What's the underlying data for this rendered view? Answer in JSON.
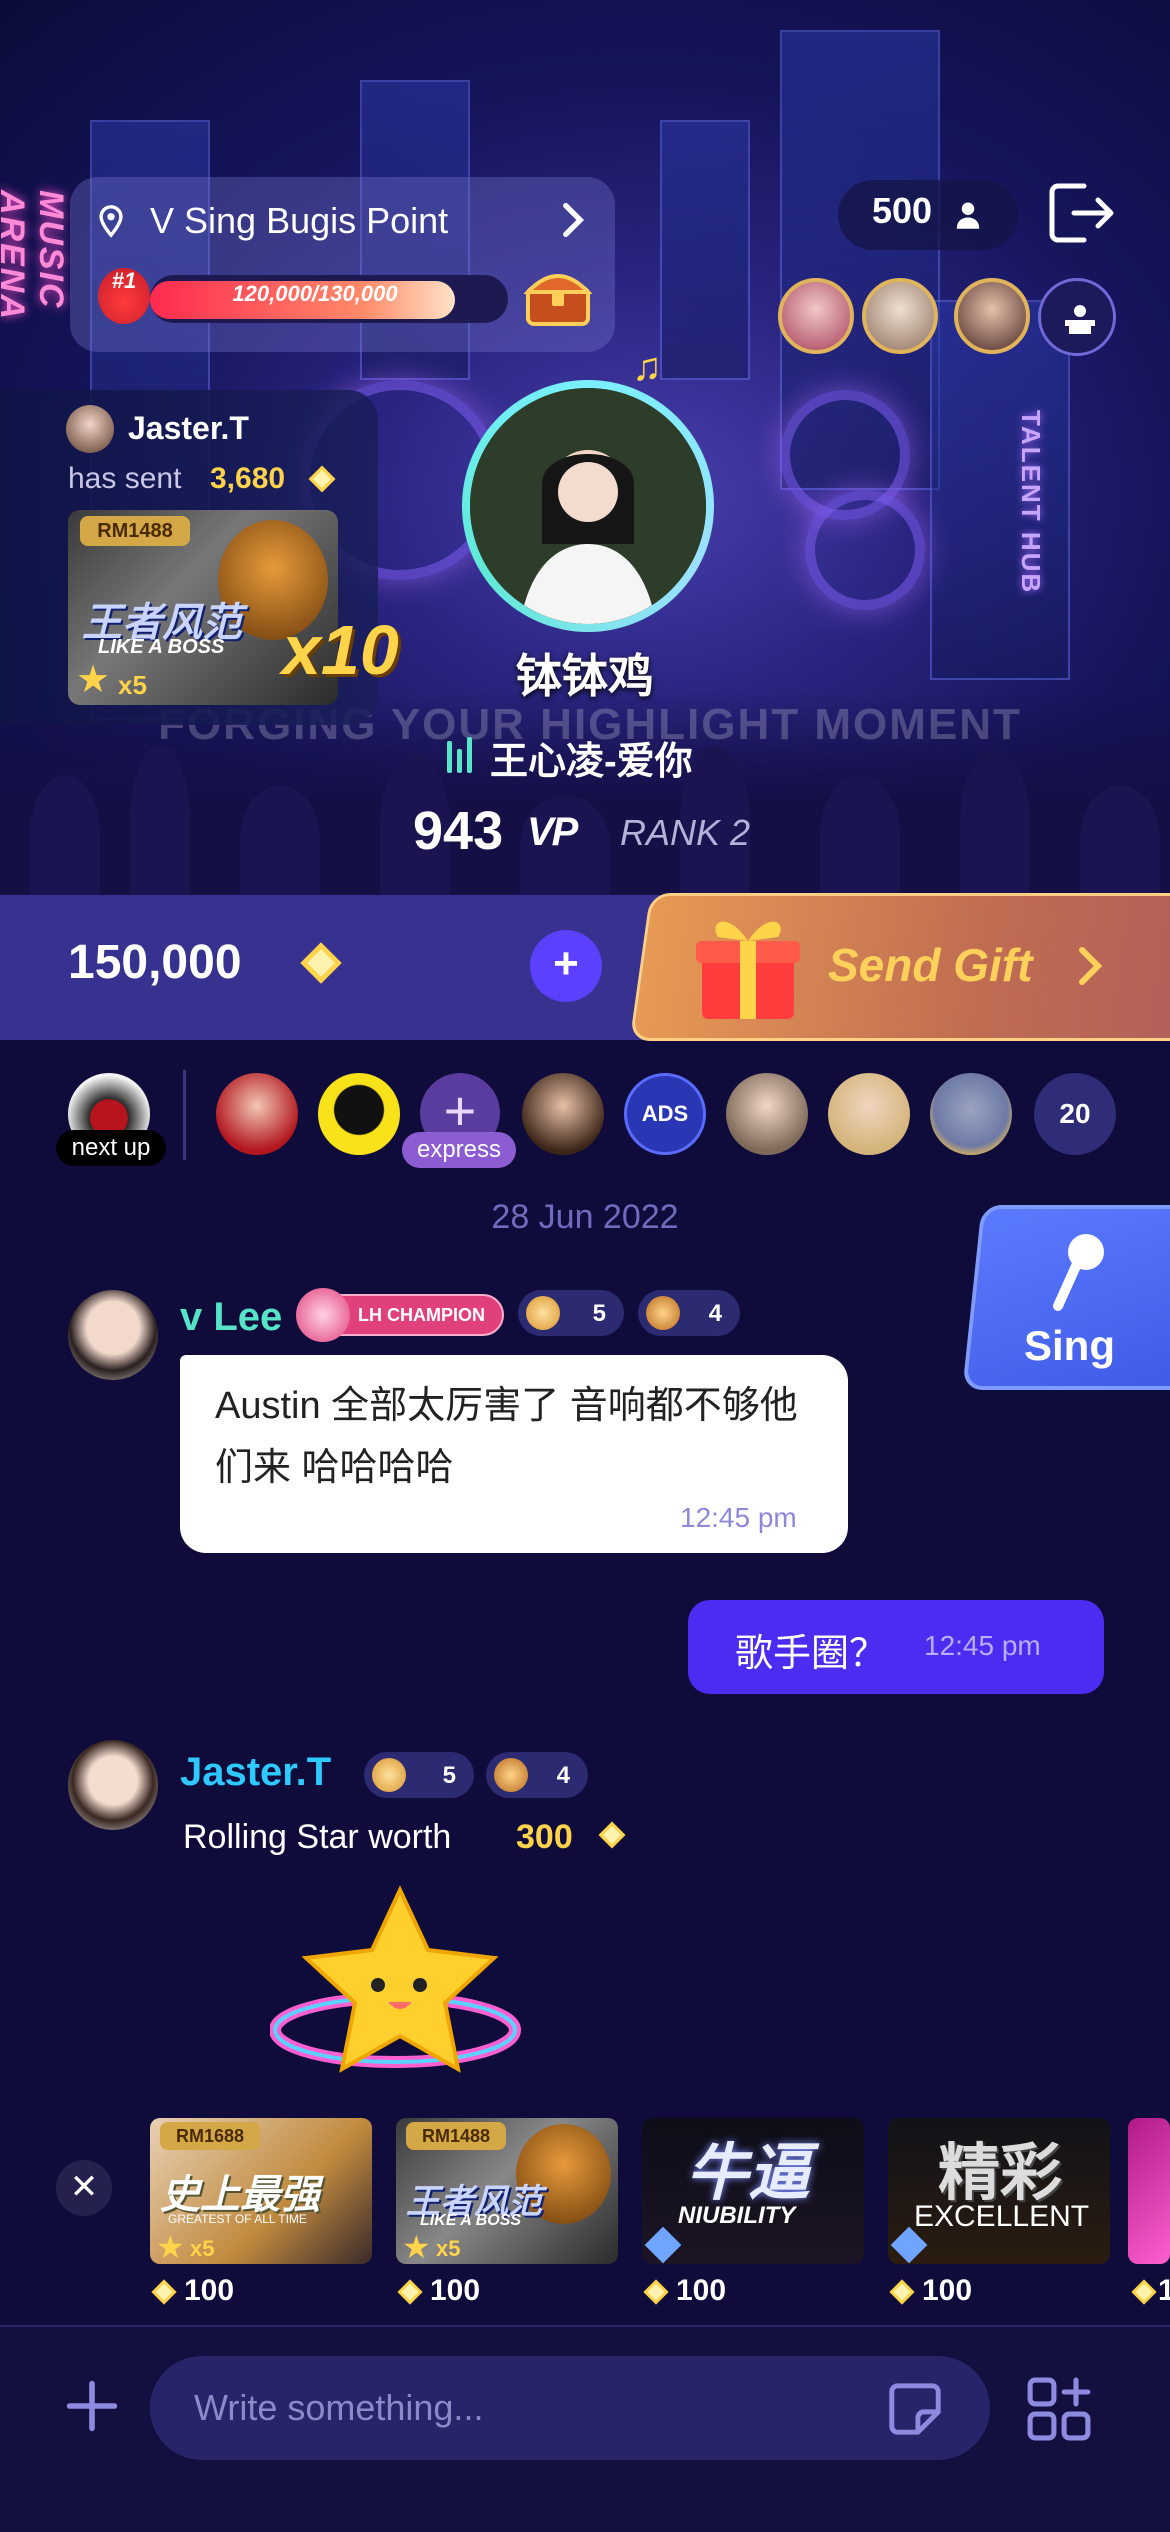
{
  "room": {
    "location_name": "V Sing Bugis Point",
    "rank_badge": "#1",
    "progress_text": "120,000/130,000",
    "progress_fraction": 0.923,
    "online_count": "500"
  },
  "signs": {
    "left": "MUSIC ARENA",
    "right": "TALENT HUB",
    "stage": "FORGING YOUR HIGHLIGHT MOMENT"
  },
  "gift_notice": {
    "sender": "Jaster.T",
    "sent_text": "has sent",
    "amount": "3,680",
    "card_worth": "RM1488",
    "card_title_cn": "王者风范",
    "card_title_en": "LIKE A BOSS",
    "card_stars": "x5",
    "multiplier": "x10"
  },
  "host": {
    "name": "钵钵鸡",
    "song": "王心凌-爱你",
    "vp_value": "943",
    "vp_label": "VP",
    "rank": "RANK 2"
  },
  "wallet": {
    "balance": "150,000",
    "topup_label": "+",
    "send_gift_label": "Send Gift"
  },
  "queue": {
    "next_up_label": "next up",
    "express_label": "express",
    "ads_label": "ADS",
    "count": "20"
  },
  "chat": {
    "date": "28 Jun 2022",
    "sing_label": "Sing",
    "messages": [
      {
        "sender": "v Lee",
        "badge": "LH CHAMPION",
        "level_a": "5",
        "level_b": "4",
        "text": "Austin 全部太厉害了 音响都不够他们来 哈哈哈哈",
        "time": "12:45 pm"
      },
      {
        "sender": "me",
        "text": "歌手圈？",
        "time": "12:45 pm"
      },
      {
        "sender": "Jaster.T",
        "level_a": "5",
        "level_b": "4",
        "text": "Rolling Star worth",
        "amount": "300"
      }
    ]
  },
  "gift_tray": {
    "items": [
      {
        "worth": "RM1688",
        "title_cn": "史上最强",
        "title_en": "GREATEST OF ALL TIME",
        "stars": "x5",
        "price": "100"
      },
      {
        "worth": "RM1488",
        "title_cn": "王者风范",
        "title_en": "LIKE A BOSS",
        "stars": "x5",
        "price": "100"
      },
      {
        "title_cn": "牛逼",
        "title_en": "NIUBILITY",
        "price": "100"
      },
      {
        "title_cn": "精彩",
        "title_en": "EXCELLENT",
        "price": "100"
      },
      {
        "price": "1"
      }
    ]
  },
  "composer": {
    "placeholder": "Write something..."
  },
  "colors": {
    "background": "#0f0c3b",
    "accent_purple": "#5b41ff",
    "gold": "#ffd34a",
    "teal_name": "#56e3c7",
    "blue_name": "#2ec9ff",
    "send_gift_orange": "#e79a55"
  }
}
